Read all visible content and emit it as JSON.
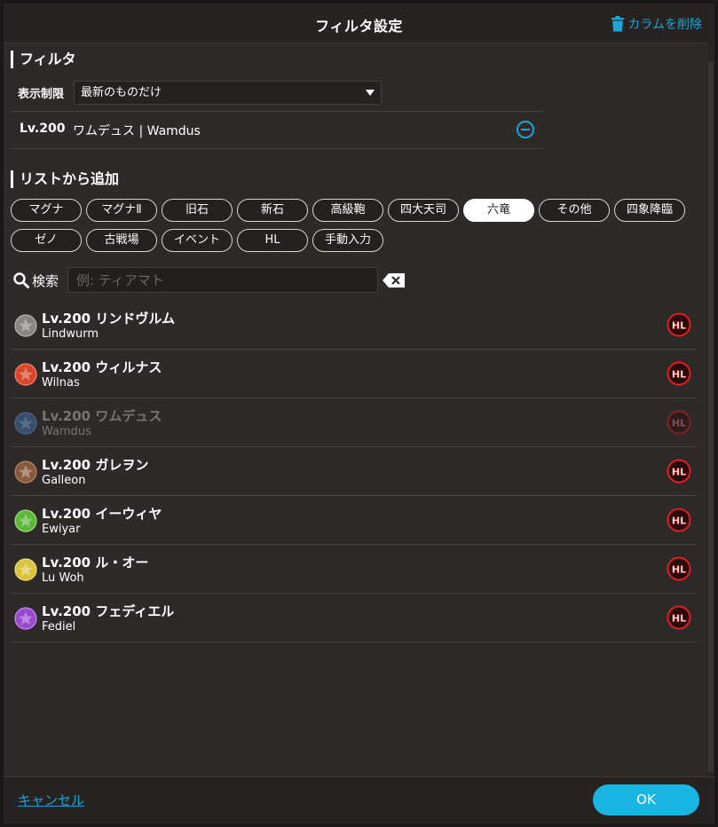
{
  "header": {
    "title": "フィルタ設定",
    "delete_column_label": "カラムを削除",
    "accent_color": "#1aa6d6"
  },
  "filter_section": {
    "title": "フィルタ",
    "limit_label": "表示制限",
    "limit_value": "最新のものだけ",
    "active_filters": [
      {
        "level": "Lv.200",
        "name": "ワムデュス | Wamdus"
      }
    ]
  },
  "add_section": {
    "title": "リストから追加",
    "categories": [
      "マグナ",
      "マグナⅡ",
      "旧石",
      "新石",
      "高級鞄",
      "四大天司",
      "六竜",
      "その他",
      "四象降臨",
      "ゼノ",
      "古戦場",
      "イベント",
      "HL",
      "手動入力"
    ],
    "active_category": "六竜"
  },
  "search": {
    "label": "検索",
    "placeholder": "例: ティアマト",
    "value": ""
  },
  "list": [
    {
      "title": "Lv.200 リンドヴルム",
      "subtitle": "Lindwurm",
      "badge": "HL",
      "element_color": "#8a8482",
      "dimmed": false
    },
    {
      "title": "Lv.200 ウィルナス",
      "subtitle": "Wilnas",
      "badge": "HL",
      "element_color": "#d8452a",
      "dimmed": false
    },
    {
      "title": "Lv.200 ワムデュス",
      "subtitle": "Wamdus",
      "badge": "HL",
      "element_color": "#3a5a8a",
      "dimmed": true
    },
    {
      "title": "Lv.200 ガレヲン",
      "subtitle": "Galleon",
      "badge": "HL",
      "element_color": "#8a5a3e",
      "dimmed": false
    },
    {
      "title": "Lv.200 イーウィヤ",
      "subtitle": "Ewiyar",
      "badge": "HL",
      "element_color": "#5cb83a",
      "dimmed": false
    },
    {
      "title": "Lv.200 ル・オー",
      "subtitle": "Lu Woh",
      "badge": "HL",
      "element_color": "#d8c43a",
      "dimmed": false
    },
    {
      "title": "Lv.200 フェディエル",
      "subtitle": "Fediel",
      "badge": "HL",
      "element_color": "#9a4ad0",
      "dimmed": false
    }
  ],
  "footer": {
    "cancel_label": "キャンセル",
    "ok_label": "OK"
  }
}
